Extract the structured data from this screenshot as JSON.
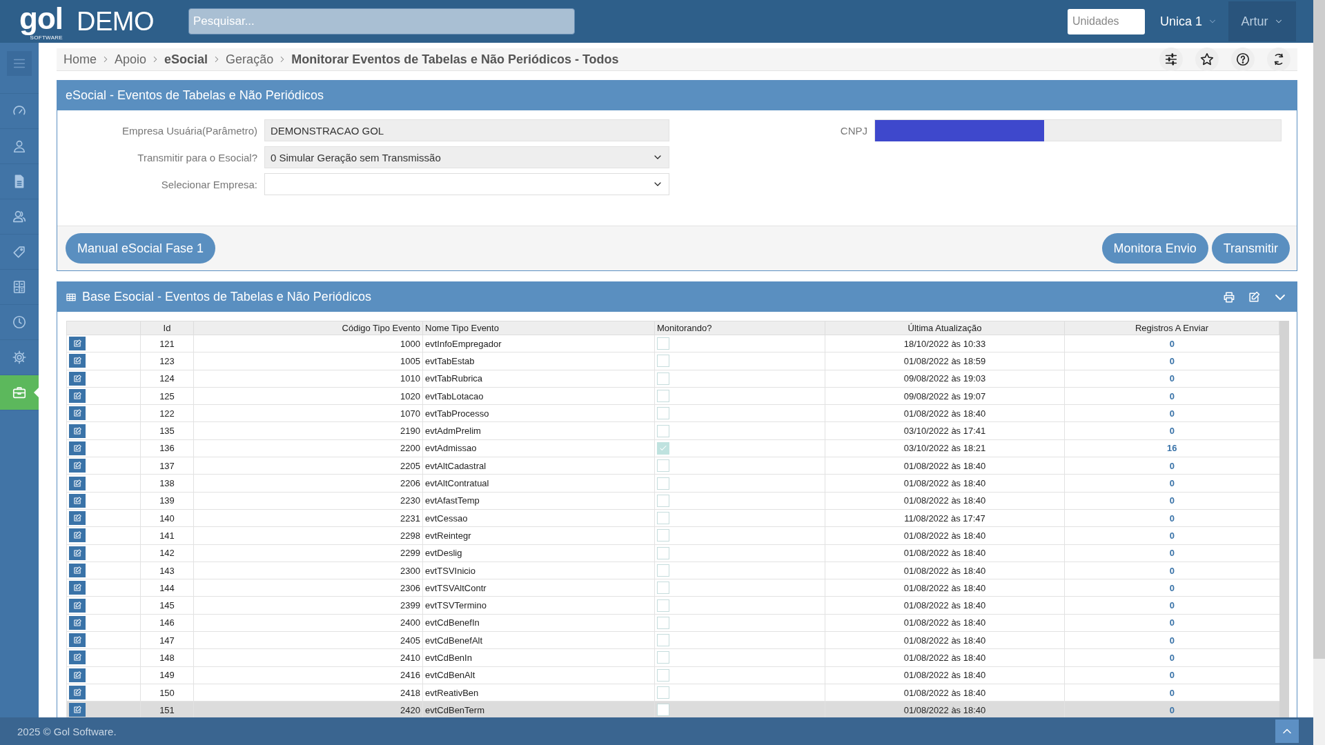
{
  "topbar": {
    "logo": "gol",
    "logo_tagline": "SOFTWARE",
    "environment": "DEMO",
    "search": {
      "placeholder": "Pesquisar..."
    },
    "units_field": {
      "placeholder": "Unidades"
    },
    "unit_menu": "Unica 1",
    "user_menu": "Artur"
  },
  "sidebar": {
    "items": [
      {
        "kind": "menu",
        "selected": false
      },
      {
        "kind": "gauge",
        "selected": false
      },
      {
        "kind": "user",
        "selected": false
      },
      {
        "kind": "document",
        "selected": false
      },
      {
        "kind": "users",
        "selected": false
      },
      {
        "kind": "tag",
        "selected": false
      },
      {
        "kind": "calculator",
        "selected": false
      },
      {
        "kind": "clock",
        "selected": false
      },
      {
        "kind": "gear",
        "selected": false
      },
      {
        "kind": "briefcase",
        "selected": true
      }
    ]
  },
  "breadcrumb": [
    {
      "label": "Home",
      "bold": false
    },
    {
      "label": "Apoio",
      "bold": false
    },
    {
      "label": "eSocial",
      "bold": true
    },
    {
      "label": "Geração",
      "bold": false
    },
    {
      "label": "Monitorar Eventos de Tabelas e Não Periódicos - Todos",
      "bold": true
    }
  ],
  "form_panel": {
    "title": "eSocial - Eventos de Tabelas e Não Periódicos",
    "fields": [
      {
        "kind": "readonly",
        "label": "Empresa Usuária(Parâmetro)",
        "value": "DEMONSTRACAO GOL"
      },
      {
        "kind": "select",
        "label": "Transmitir para o Esocial?",
        "value": "0 Simular Geração sem Transmissão",
        "filled": true
      },
      {
        "kind": "select",
        "label": "Selecionar Empresa:",
        "filled": false
      }
    ],
    "cnpj": {
      "label": "CNPJ"
    },
    "buttons_left": [
      "Manual eSocial Fase 1"
    ],
    "buttons_right": [
      "Monitora Envio",
      "Transmitir"
    ]
  },
  "table_panel": {
    "title": "Base Esocial - Eventos de Tabelas e Não Periódicos",
    "columns": [
      "Id",
      "Código Tipo Evento",
      "Nome Tipo Evento",
      "Monitorando?",
      "Última Atualização",
      "Registros A Enviar"
    ],
    "rows": [
      {
        "id": "121",
        "code": "1000",
        "name": "evtInfoEmpregador",
        "monitoring": false,
        "updated": "18/10/2022 às 10:33",
        "pending": "0",
        "selected": false
      },
      {
        "id": "123",
        "code": "1005",
        "name": "evtTabEstab",
        "monitoring": false,
        "updated": "01/08/2022 às 18:59",
        "pending": "0",
        "selected": false
      },
      {
        "id": "124",
        "code": "1010",
        "name": "evtTabRubrica",
        "monitoring": false,
        "updated": "09/08/2022 às 19:03",
        "pending": "0",
        "selected": false
      },
      {
        "id": "125",
        "code": "1020",
        "name": "evtTabLotacao",
        "monitoring": false,
        "updated": "09/08/2022 às 19:07",
        "pending": "0",
        "selected": false
      },
      {
        "id": "122",
        "code": "1070",
        "name": "evtTabProcesso",
        "monitoring": false,
        "updated": "01/08/2022 às 18:40",
        "pending": "0",
        "selected": false
      },
      {
        "id": "135",
        "code": "2190",
        "name": "evtAdmPrelim",
        "monitoring": false,
        "updated": "03/10/2022 às 17:41",
        "pending": "0",
        "selected": false
      },
      {
        "id": "136",
        "code": "2200",
        "name": "evtAdmissao",
        "monitoring": true,
        "updated": "03/10/2022 às 18:21",
        "pending": "16",
        "selected": false
      },
      {
        "id": "137",
        "code": "2205",
        "name": "evtAltCadastral",
        "monitoring": false,
        "updated": "01/08/2022 às 18:40",
        "pending": "0",
        "selected": false
      },
      {
        "id": "138",
        "code": "2206",
        "name": "evtAltContratual",
        "monitoring": false,
        "updated": "01/08/2022 às 18:40",
        "pending": "0",
        "selected": false
      },
      {
        "id": "139",
        "code": "2230",
        "name": "evtAfastTemp",
        "monitoring": false,
        "updated": "01/08/2022 às 18:40",
        "pending": "0",
        "selected": false
      },
      {
        "id": "140",
        "code": "2231",
        "name": "evtCessao",
        "monitoring": false,
        "updated": "11/08/2022 às 17:47",
        "pending": "0",
        "selected": false
      },
      {
        "id": "141",
        "code": "2298",
        "name": "evtReintegr",
        "monitoring": false,
        "updated": "01/08/2022 às 18:40",
        "pending": "0",
        "selected": false
      },
      {
        "id": "142",
        "code": "2299",
        "name": "evtDeslig",
        "monitoring": false,
        "updated": "01/08/2022 às 18:40",
        "pending": "0",
        "selected": false
      },
      {
        "id": "143",
        "code": "2300",
        "name": "evtTSVInicio",
        "monitoring": false,
        "updated": "01/08/2022 às 18:40",
        "pending": "0",
        "selected": false
      },
      {
        "id": "144",
        "code": "2306",
        "name": "evtTSVAltContr",
        "monitoring": false,
        "updated": "01/08/2022 às 18:40",
        "pending": "0",
        "selected": false
      },
      {
        "id": "145",
        "code": "2399",
        "name": "evtTSVTermino",
        "monitoring": false,
        "updated": "01/08/2022 às 18:40",
        "pending": "0",
        "selected": false
      },
      {
        "id": "146",
        "code": "2400",
        "name": "evtCdBenefIn",
        "monitoring": false,
        "updated": "01/08/2022 às 18:40",
        "pending": "0",
        "selected": false
      },
      {
        "id": "147",
        "code": "2405",
        "name": "evtCdBenefAlt",
        "monitoring": false,
        "updated": "01/08/2022 às 18:40",
        "pending": "0",
        "selected": false
      },
      {
        "id": "148",
        "code": "2410",
        "name": "evtCdBenIn",
        "monitoring": false,
        "updated": "01/08/2022 às 18:40",
        "pending": "0",
        "selected": false
      },
      {
        "id": "149",
        "code": "2416",
        "name": "evtCdBenAlt",
        "monitoring": false,
        "updated": "01/08/2022 às 18:40",
        "pending": "0",
        "selected": false
      },
      {
        "id": "150",
        "code": "2418",
        "name": "evtReativBen",
        "monitoring": false,
        "updated": "01/08/2022 às 18:40",
        "pending": "0",
        "selected": false
      },
      {
        "id": "151",
        "code": "2420",
        "name": "evtCdBenTerm",
        "monitoring": false,
        "updated": "01/08/2022 às 18:40",
        "pending": "0",
        "selected": true
      }
    ]
  },
  "footer": {
    "copyright": "2025 © Gol Software."
  }
}
